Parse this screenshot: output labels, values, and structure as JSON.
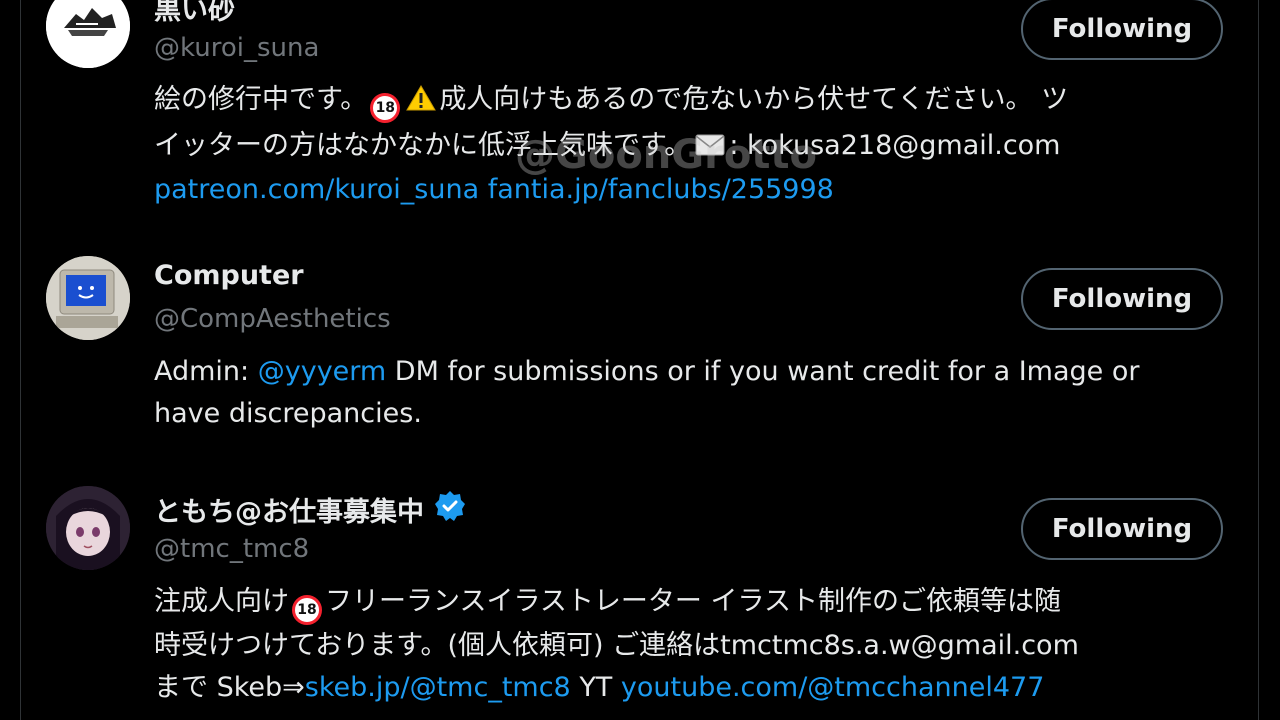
{
  "users": [
    {
      "display_name": "黒い砂",
      "handle": "@kuroi_suna",
      "avatar_icon": "ink-sketch-avatar",
      "bio_lines": [
        {
          "segments": [
            {
              "text": "絵の修行中です。"
            },
            {
              "badge": "18"
            },
            {
              "icon": "warning-icon"
            },
            {
              "text": "成人向けもあるので危ないから伏せてください。 ツ"
            }
          ]
        },
        {
          "segments": [
            {
              "text": "イッターの方はなかなかに低浮上気味です。"
            },
            {
              "icon": "envelope-icon"
            },
            {
              "text": ": kokusa218@gmail.com"
            }
          ]
        },
        {
          "segments": [
            {
              "text": "patreon.com/kuroi_suna fantia.jp/fanclubs/255998",
              "link": true
            }
          ]
        }
      ],
      "button_label": "Following"
    },
    {
      "display_name": "Computer",
      "handle": "@CompAesthetics",
      "avatar_icon": "retro-computer-avatar",
      "bio_lines": [
        {
          "segments": [
            {
              "text": "Admin: "
            },
            {
              "text": "@yyyerm",
              "link": true
            },
            {
              "text": " DM for submissions or if you want credit for a Image or"
            }
          ]
        },
        {
          "segments": [
            {
              "text": "have discrepancies."
            }
          ]
        }
      ],
      "button_label": "Following"
    },
    {
      "display_name": "ともち@お仕事募集中",
      "handle": "@tmc_tmc8",
      "avatar_icon": "anime-girl-avatar",
      "verified": true,
      "bio_lines": [
        {
          "segments": [
            {
              "text": "注成人向け"
            },
            {
              "badge": "18"
            },
            {
              "text": "フリーランスイラストレーター イラスト制作のご依頼等は随"
            }
          ]
        },
        {
          "segments": [
            {
              "text": "時受けつけております。(個人依頼可) ご連絡はtmctmc8s.a.w@gmail.com"
            }
          ]
        },
        {
          "segments": [
            {
              "text": "まで Skeb⇒"
            },
            {
              "text": "skeb.jp/@tmc_tmc8",
              "link": true
            },
            {
              "text": " YT "
            },
            {
              "text": "youtube.com/@tmcchannel477",
              "link": true
            }
          ]
        }
      ],
      "button_label": "Following"
    }
  ],
  "watermark": "@GoonGrotto",
  "colors": {
    "background": "#000000",
    "text": "#e7e9ea",
    "muted": "#71767b",
    "link": "#1d9bf0",
    "button_border": "#536471",
    "verified": "#1d9bf0",
    "badge_red": "#f4212e"
  }
}
